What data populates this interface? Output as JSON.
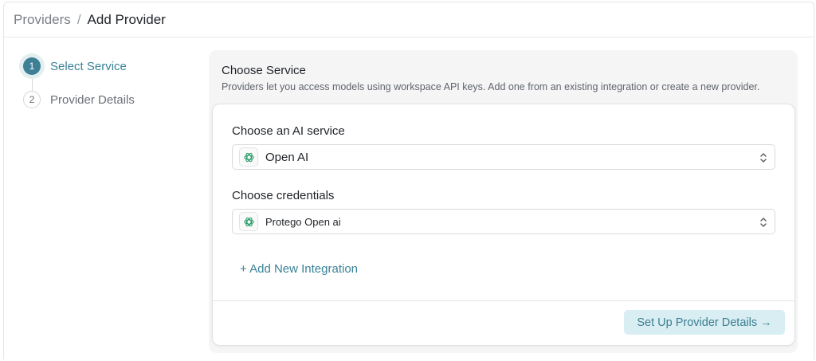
{
  "breadcrumb": {
    "parent": "Providers",
    "separator": "/",
    "current": "Add Provider"
  },
  "stepper": {
    "steps": [
      {
        "number": "1",
        "label": "Select Service",
        "active": true
      },
      {
        "number": "2",
        "label": "Provider Details",
        "active": false
      }
    ]
  },
  "panel": {
    "title": "Choose Service",
    "description": "Providers let you access models using workspace API keys. Add one from an existing integration or create a new provider."
  },
  "form": {
    "service": {
      "label": "Choose an AI service",
      "value": "Open AI",
      "icon": "openai-logo-icon"
    },
    "credentials": {
      "label": "Choose credentials",
      "value": "Protego Open ai",
      "icon": "openai-logo-icon"
    },
    "add_integration": "+ Add New Integration",
    "submit": "Set Up Provider Details →"
  },
  "colors": {
    "accent": "#3a8297",
    "button_bg": "#d9eef3",
    "panel_bg": "#f5f5f6"
  }
}
